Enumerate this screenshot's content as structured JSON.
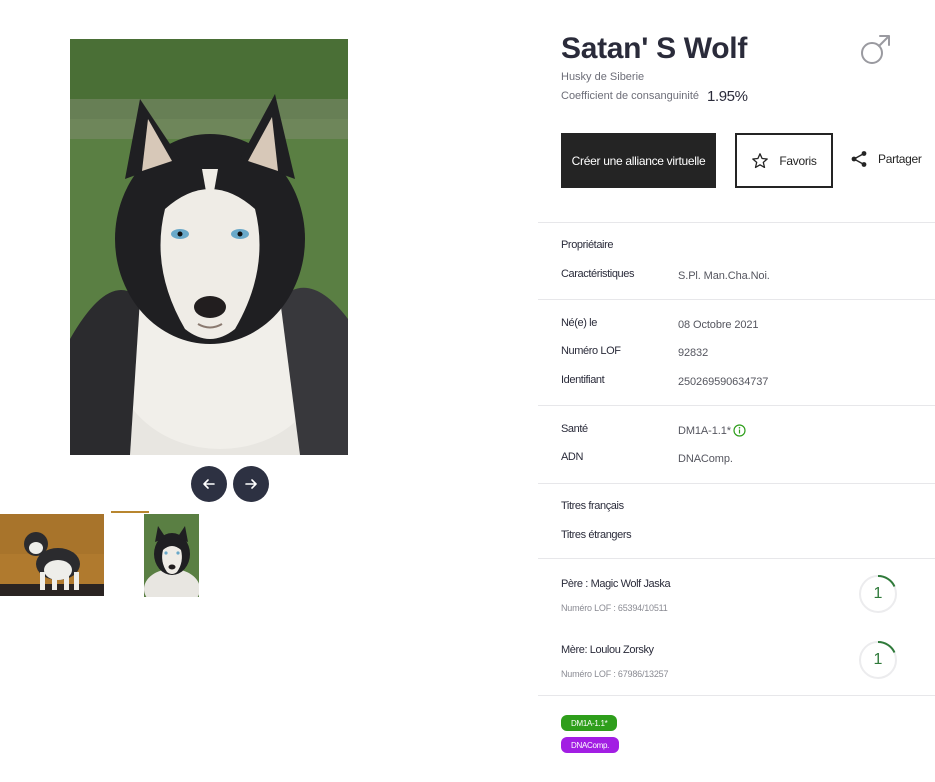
{
  "dog": {
    "name": "Satan' S Wolf",
    "breed": "Husky de Siberie",
    "coefficient_label": "Coefficient de consanguinité",
    "coefficient_value": "1.95%",
    "sex_icon": "male-icon"
  },
  "actions": {
    "create_alliance": "Créer une alliance virtuelle",
    "favorites": "Favoris",
    "share": "Partager"
  },
  "details": {
    "owner_label": "Propriétaire",
    "characteristics_label": "Caractéristiques",
    "characteristics_value": "S.Pl. Man.Cha.Noi.",
    "born_label": "Né(e) le",
    "born_value": "08 Octobre 2021",
    "lof_label": "Numéro LOF",
    "lof_value": "92832",
    "identifier_label": "Identifiant",
    "identifier_value": "250269590634737",
    "health_label": "Santé",
    "health_value": "DM1A-1.1*",
    "dna_label": "ADN",
    "dna_value": "DNAComp.",
    "french_titles_label": "Titres français",
    "foreign_titles_label": "Titres étrangers"
  },
  "parents": {
    "father_name": "Père : Magic Wolf Jaska",
    "father_lof": "Numéro LOF : 65394/10511",
    "father_badge": "1",
    "mother_name": "Mère: Loulou Zorsky",
    "mother_lof": "Numéro LOF : 67986/13257",
    "mother_badge": "1"
  },
  "tags": {
    "health_tag": "DM1A-1.1*",
    "dna_tag": "DNAComp."
  },
  "colors": {
    "primary_dark": "#242424",
    "nav_button": "#2d3142",
    "accent_gold": "#b8862f",
    "tag_green": "#2e9e1b",
    "tag_purple": "#a21ee3",
    "badge_green": "#2f7a3a"
  },
  "gallery": {
    "prev_icon": "arrow-left-icon",
    "next_icon": "arrow-right-icon",
    "thumbnail_count": 2
  }
}
